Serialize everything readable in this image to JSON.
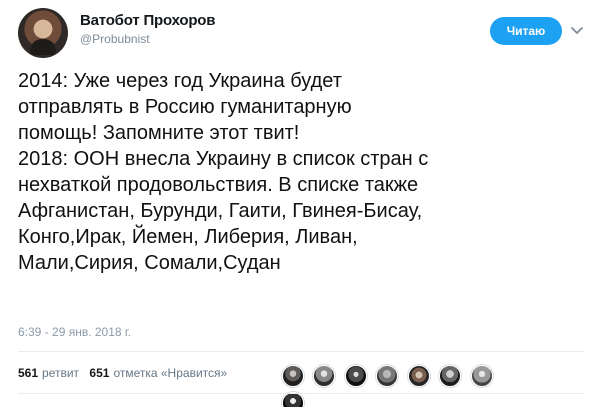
{
  "tweet": {
    "display_name": "Ватобот Прохоров",
    "handle": "@Probubnist",
    "follow_label": "Читаю",
    "text_lines": [
      "2014: Уже через год Украина будет",
      "отправлять в Россию гуманитарную",
      "помощь! Запомните этот твит!",
      "2018: ООН внесла Украину в список стран с",
      "нехваткой продовольствия. В списке также",
      "Афганистан, Бурунди, Гаити, Гвинея-Бисау,",
      "Конго,Ирак, Йемен, Либерия, Ливан,",
      "Мали,Сирия, Сомали,Судан"
    ],
    "timestamp": "6:39 - 29 янв. 2018 г."
  },
  "stats": {
    "retweets_count": "561",
    "retweets_label": "ретвит",
    "likes_count": "651",
    "likes_label": "отметка «Нравится»"
  },
  "icons": {
    "profile": "avatar",
    "menu": "chevron-down-icon",
    "likers": "liker-avatars"
  },
  "colors": {
    "accent": "#1da1f2",
    "text": "#14171a",
    "muted": "#657786",
    "divider": "#e6ecf0"
  }
}
